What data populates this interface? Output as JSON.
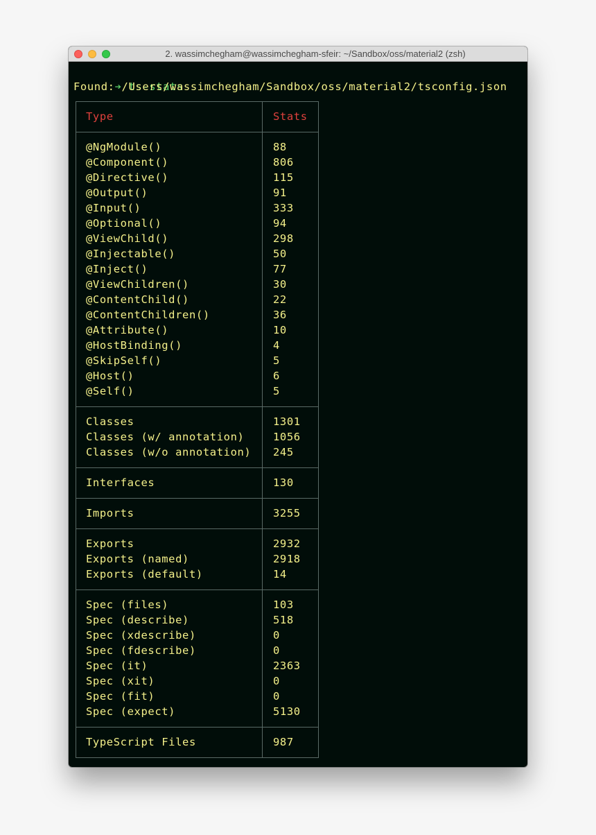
{
  "window": {
    "title": "2. wassimchegham@wassimchegham-sfeir: ~/Sandbox/oss/material2 (zsh)"
  },
  "terminal": {
    "prompt_symbol": "➔",
    "command": "ts-stats",
    "found_line": "Found: /Users/wassimchegham/Sandbox/oss/material2/tsconfig.json"
  },
  "table": {
    "headers": {
      "type": "Type",
      "stats": "Stats"
    },
    "groups": [
      {
        "rows": [
          {
            "type": "@NgModule()",
            "stats": "88"
          },
          {
            "type": "@Component()",
            "stats": "806"
          },
          {
            "type": "@Directive()",
            "stats": "115"
          },
          {
            "type": "@Output()",
            "stats": "91"
          },
          {
            "type": "@Input()",
            "stats": "333"
          },
          {
            "type": "@Optional()",
            "stats": "94"
          },
          {
            "type": "@ViewChild()",
            "stats": "298"
          },
          {
            "type": "@Injectable()",
            "stats": "50"
          },
          {
            "type": "@Inject()",
            "stats": "77"
          },
          {
            "type": "@ViewChildren()",
            "stats": "30"
          },
          {
            "type": "@ContentChild()",
            "stats": "22"
          },
          {
            "type": "@ContentChildren()",
            "stats": "36"
          },
          {
            "type": "@Attribute()",
            "stats": "10"
          },
          {
            "type": "@HostBinding()",
            "stats": "4"
          },
          {
            "type": "@SkipSelf()",
            "stats": "5"
          },
          {
            "type": "@Host()",
            "stats": "6"
          },
          {
            "type": "@Self()",
            "stats": "5"
          }
        ]
      },
      {
        "rows": [
          {
            "type": "Classes",
            "stats": "1301"
          },
          {
            "type": "Classes (w/ annotation)",
            "stats": "1056"
          },
          {
            "type": "Classes (w/o annotation)",
            "stats": "245"
          }
        ]
      },
      {
        "rows": [
          {
            "type": "Interfaces",
            "stats": "130"
          }
        ]
      },
      {
        "rows": [
          {
            "type": "Imports",
            "stats": "3255"
          }
        ]
      },
      {
        "rows": [
          {
            "type": "Exports",
            "stats": "2932"
          },
          {
            "type": "Exports (named)",
            "stats": "2918"
          },
          {
            "type": "Exports (default)",
            "stats": "14"
          }
        ]
      },
      {
        "rows": [
          {
            "type": "Spec (files)",
            "stats": "103"
          },
          {
            "type": "Spec (describe)",
            "stats": "518"
          },
          {
            "type": "Spec (xdescribe)",
            "stats": "0"
          },
          {
            "type": "Spec (fdescribe)",
            "stats": "0"
          },
          {
            "type": "Spec (it)",
            "stats": "2363"
          },
          {
            "type": "Spec (xit)",
            "stats": "0"
          },
          {
            "type": "Spec (fit)",
            "stats": "0"
          },
          {
            "type": "Spec (expect)",
            "stats": "5130"
          }
        ]
      },
      {
        "rows": [
          {
            "type": "TypeScript Files",
            "stats": "987"
          }
        ]
      }
    ]
  },
  "colors": {
    "terminal_bg": "#010d09",
    "text": "#f4f08a",
    "prompt": "#5fd36a",
    "header": "#e0413d",
    "border": "#5a6a66"
  }
}
